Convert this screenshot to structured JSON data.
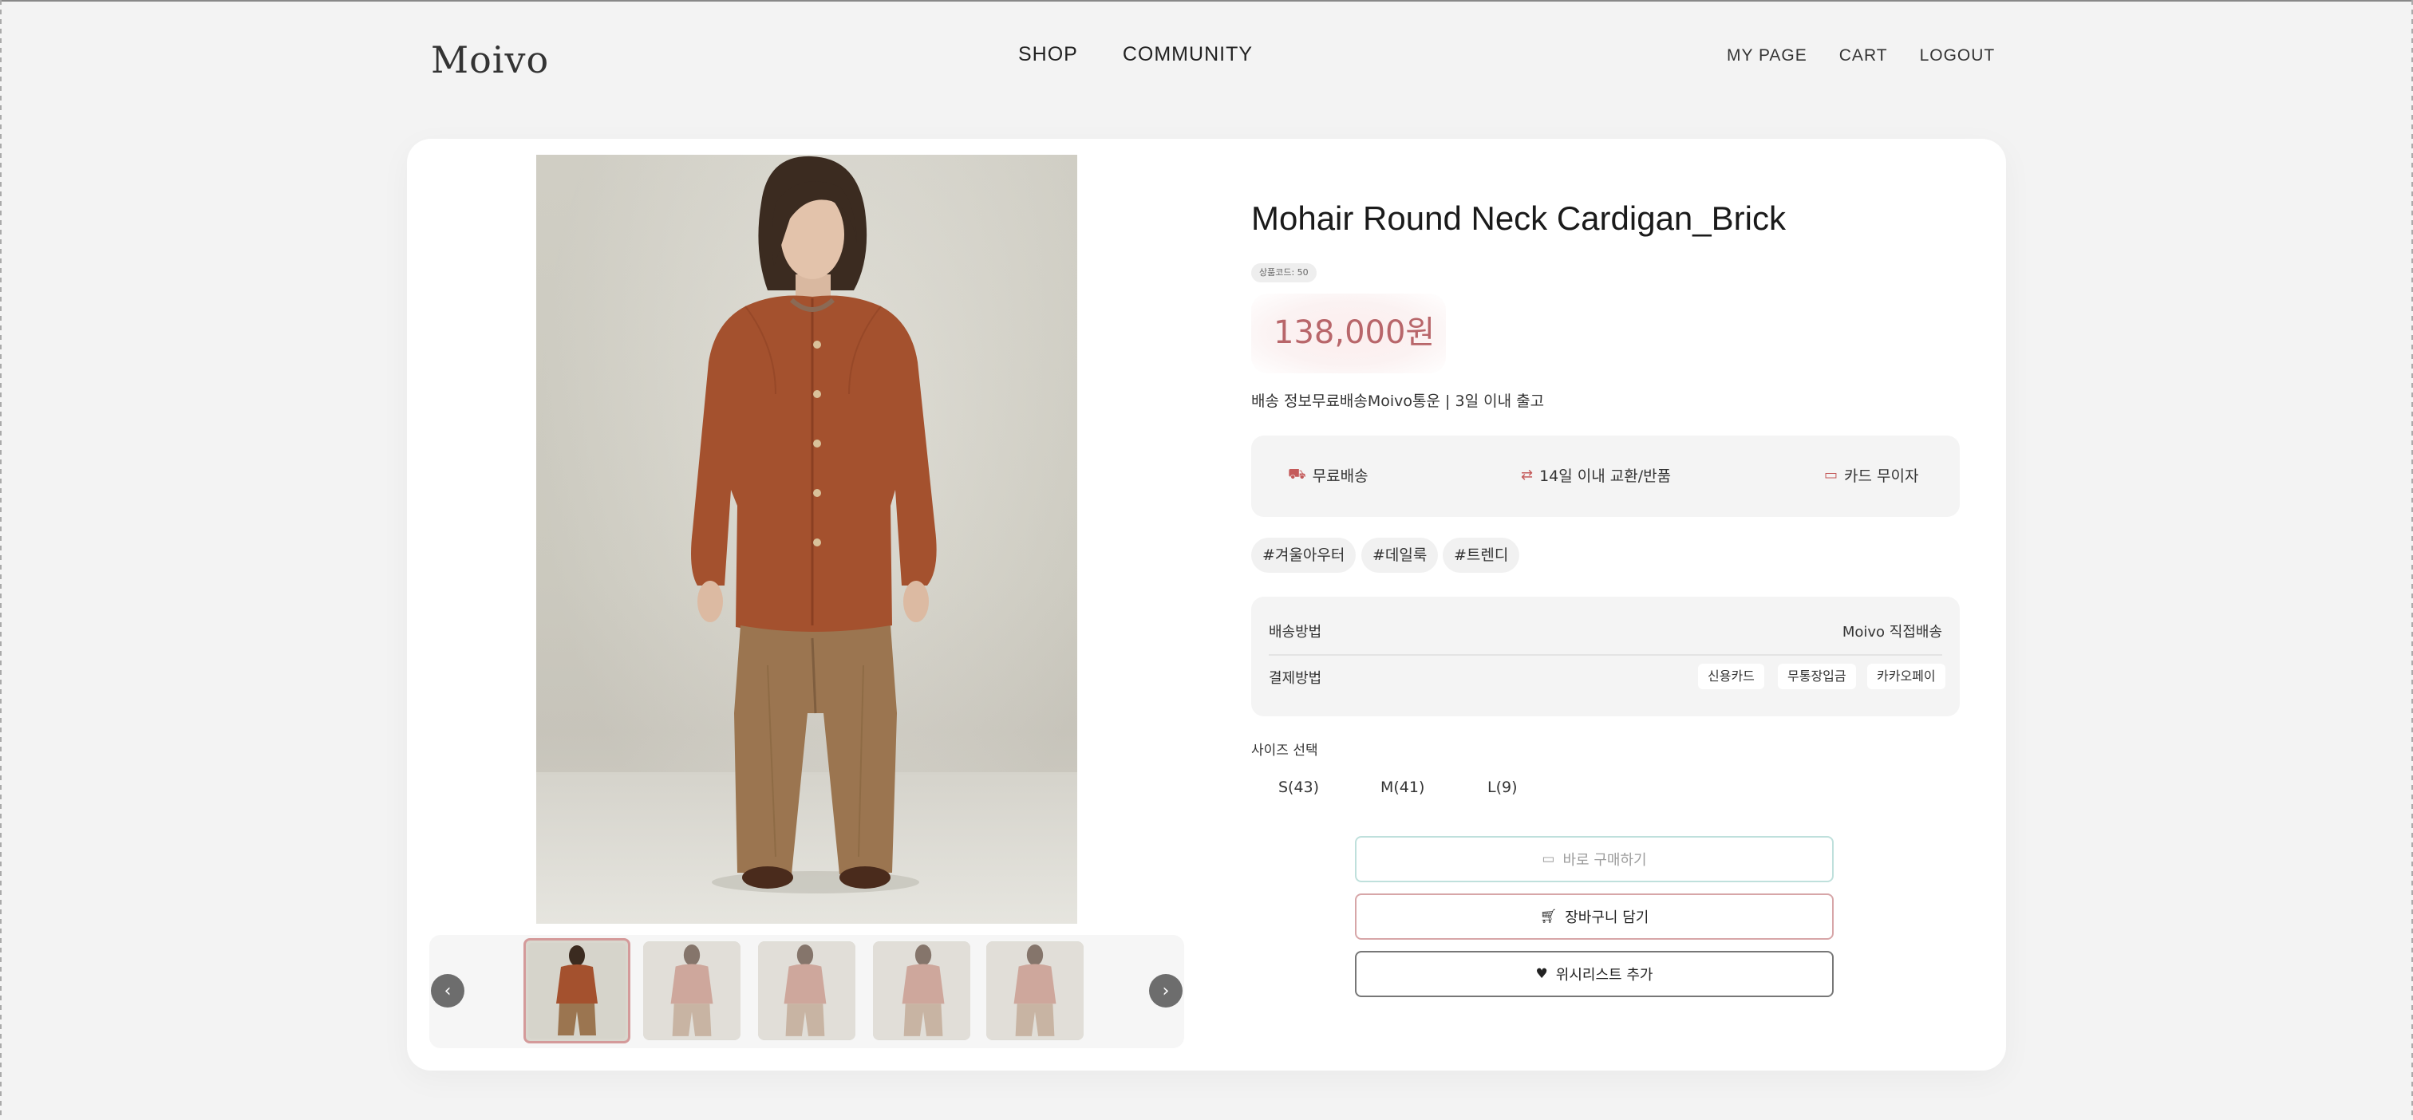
{
  "header": {
    "logo": "Moivo",
    "nav_center": [
      "SHOP",
      "COMMUNITY"
    ],
    "nav_right": [
      "MY PAGE",
      "CART",
      "LOGOUT"
    ]
  },
  "product": {
    "title": "Mohair Round Neck Cardigan_Brick",
    "code_label": "상품코드: 50",
    "price": "138,000원",
    "shipping_info": "배송 정보무료배송Moivo통운 | 3일 이내 출고",
    "benefits": [
      {
        "icon": "truck-icon",
        "label": "무료배송"
      },
      {
        "icon": "exchange-icon",
        "label": "14일 이내 교환/반품"
      },
      {
        "icon": "card-icon",
        "label": "카드 무이자"
      }
    ],
    "tags": [
      "#겨울아우터",
      "#데일룩",
      "#트렌디"
    ],
    "delivery_method_label": "배송방법",
    "delivery_method_value": "Moivo 직접배송",
    "payment_method_label": "결제방법",
    "payment_methods": [
      "신용카드",
      "무통장입금",
      "카카오페이"
    ],
    "size_label": "사이즈 선택",
    "sizes": [
      "S(43)",
      "M(41)",
      "L(9)"
    ],
    "buttons": {
      "buy": "바로 구매하기",
      "cart": "장바구니 담기",
      "wishlist": "위시리스트 추가"
    }
  },
  "gallery": {
    "prev": "‹",
    "next": "›",
    "thumbnail_count": 5,
    "active_index": 0
  },
  "colors": {
    "price": "#b8666a",
    "accent_icon": "#c45a5a",
    "cardigan": "#a4512e",
    "pants": "#9b7550"
  }
}
